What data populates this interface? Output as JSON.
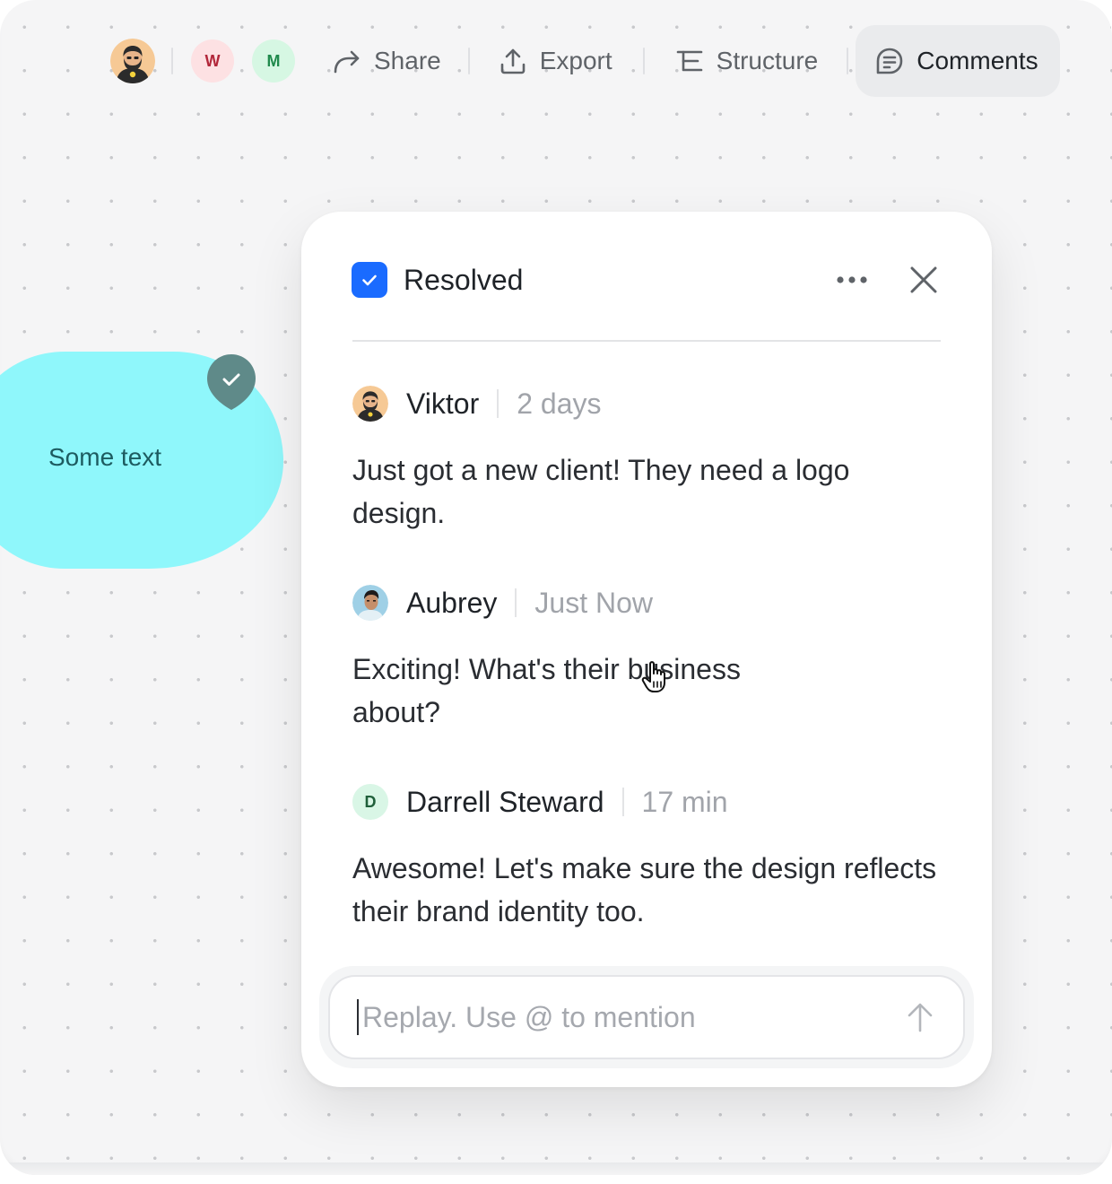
{
  "toolbar": {
    "avatars": [
      {
        "type": "photo",
        "name": "current-user"
      },
      {
        "type": "letter",
        "initial": "W",
        "bg": "#fde1e3",
        "fg": "#b2273a"
      },
      {
        "type": "letter",
        "initial": "M",
        "bg": "#d6f7e3",
        "fg": "#1f8a4c"
      }
    ],
    "share_label": "Share",
    "export_label": "Export",
    "structure_label": "Structure",
    "comments_label": "Comments",
    "icons": [
      "share-arrow-icon",
      "export-upload-icon",
      "structure-tree-icon",
      "comments-bubble-icon"
    ]
  },
  "canvas": {
    "shape_text": "Some text",
    "shape_color": "#8ff7fb",
    "pin_icon": "check-icon"
  },
  "panel": {
    "status_label": "Resolved",
    "status_checked": true,
    "accent": "#1a6bff",
    "comments": [
      {
        "author": "Viktor",
        "time": "2 days",
        "avatar": "photo",
        "text": "Just got a new client! They need a logo design."
      },
      {
        "author": "Aubrey",
        "time": "Just Now",
        "avatar": "photo",
        "text": "Exciting! What's their business about?"
      },
      {
        "author": "Darrell Steward",
        "time": "17 min",
        "avatar": "letter",
        "initial": "D",
        "avatar_bg": "#d9f6e6",
        "avatar_fg": "#1f5f3a",
        "text": "Awesome! Let's make sure the design reflects their brand identity too."
      }
    ],
    "reply_placeholder": "Replay. Use @ to mention"
  }
}
